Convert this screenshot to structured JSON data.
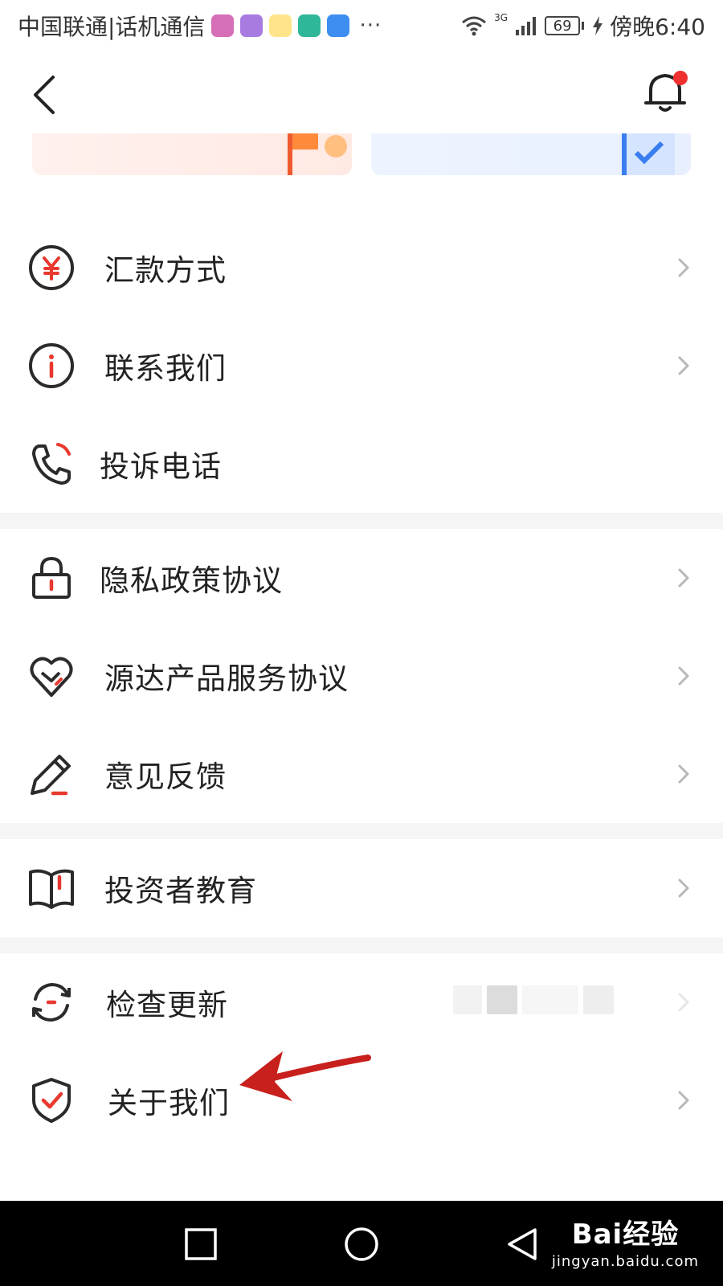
{
  "status_bar": {
    "carrier": "中国联通|话机通信",
    "battery": "69",
    "network": "3G",
    "time": "傍晚6:40",
    "more": "···"
  },
  "header": {
    "back_icon": "chevron-left-icon",
    "bell_icon": "bell-icon",
    "has_notification_dot": true
  },
  "menu": {
    "group1": [
      {
        "label": "汇款方式",
        "icon": "yuan-circle-icon",
        "chevron": true
      },
      {
        "label": "联系我们",
        "icon": "info-circle-icon",
        "chevron": true
      },
      {
        "label": "投诉电话",
        "icon": "phone-icon",
        "chevron": false
      }
    ],
    "group2": [
      {
        "label": "隐私政策协议",
        "icon": "lock-icon",
        "chevron": true
      },
      {
        "label": "源达产品服务协议",
        "icon": "handshake-heart-icon",
        "chevron": true
      },
      {
        "label": "意见反馈",
        "icon": "pencil-icon",
        "chevron": true
      }
    ],
    "group3": [
      {
        "label": "投资者教育",
        "icon": "book-icon",
        "chevron": true
      }
    ],
    "group4": [
      {
        "label": "检查更新",
        "icon": "refresh-icon",
        "chevron": true
      },
      {
        "label": "关于我们",
        "icon": "shield-check-icon",
        "chevron": true
      }
    ]
  },
  "watermark": {
    "main": "Bai经验",
    "sub": "jingyan.baidu.com"
  },
  "colors": {
    "accent_red": "#e8392f",
    "icon_dark": "#2b2b2b",
    "divider": "#f5f5f5",
    "chevron": "#b8b8b8"
  }
}
